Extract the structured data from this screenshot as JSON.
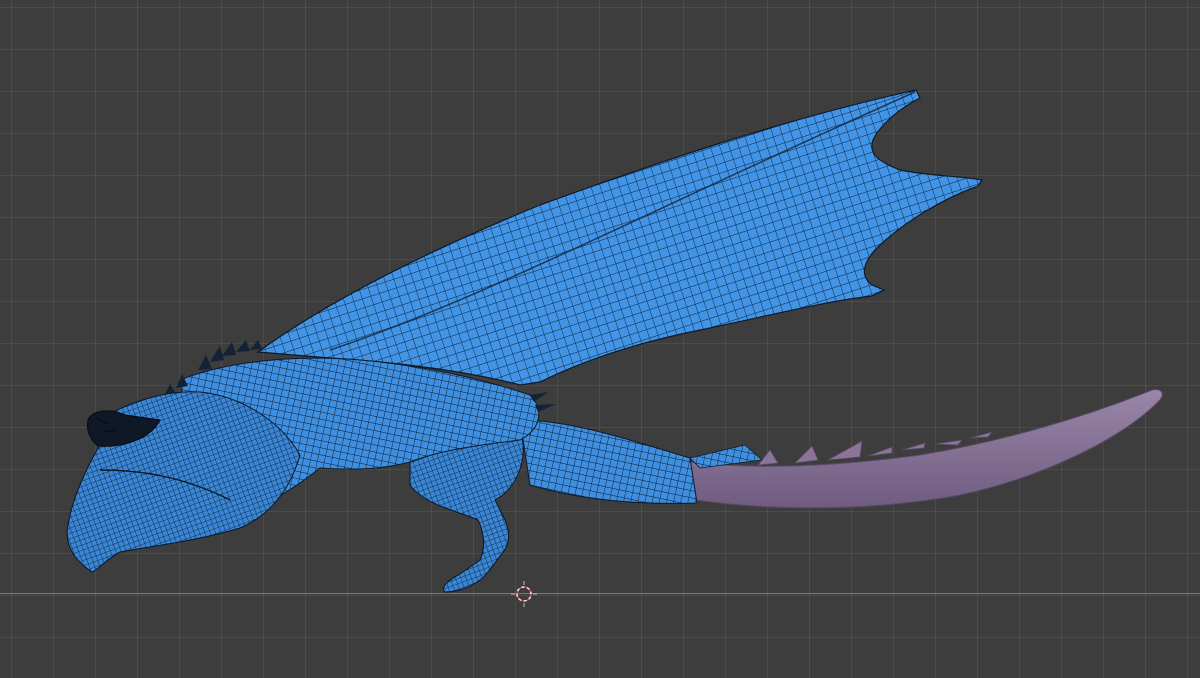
{
  "viewport": {
    "background_color": "#3d3d3d",
    "grid_color": "#4a4a4a",
    "x_axis_color": "#6e8a3a"
  },
  "model": {
    "mesh_color": "#3f8fe0",
    "wire_color": "#0d1a2a",
    "tail_color": "#8a7497"
  },
  "cursor": {
    "icon": "3d-cursor-icon",
    "ring_color": "#d04040"
  }
}
